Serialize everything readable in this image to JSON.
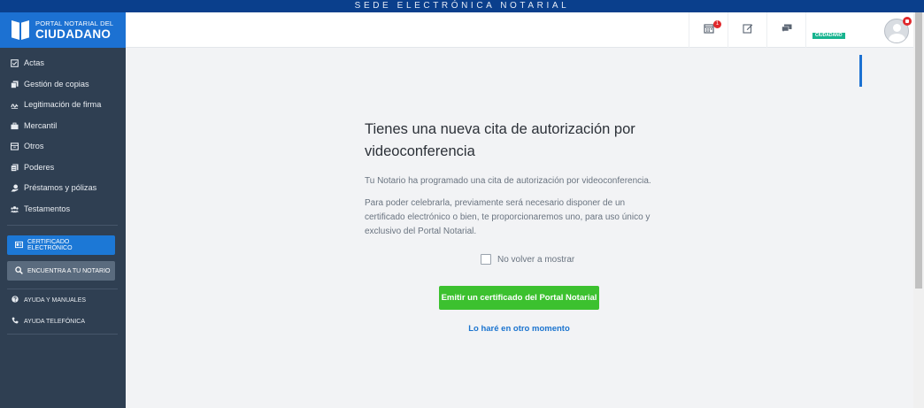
{
  "banner": "SEDE ELECTRÓNICA NOTARIAL",
  "logo": {
    "line1": "PORTAL NOTARIAL DEL",
    "line2": "CIUDADANO"
  },
  "header": {
    "calendar_badge": "1",
    "role_tag": "CIUDADANO"
  },
  "sidebar": {
    "items": [
      {
        "label": "Actas",
        "icon": "check-square-icon"
      },
      {
        "label": "Gestión de copias",
        "icon": "copy-icon"
      },
      {
        "label": "Legitimación de firma",
        "icon": "signature-icon"
      },
      {
        "label": "Mercantil",
        "icon": "briefcase-icon"
      },
      {
        "label": "Otros",
        "icon": "box-icon"
      },
      {
        "label": "Poderes",
        "icon": "documents-icon"
      },
      {
        "label": "Préstamos y pólizas",
        "icon": "hand-coin-icon"
      },
      {
        "label": "Testamentos",
        "icon": "people-icon"
      }
    ],
    "cert_button": "CERTIFICADO ELECTRÓNICO",
    "find_button": "ENCUENTRA A TU NOTARIO",
    "help": [
      {
        "label": "AYUDA Y MANUALES",
        "icon": "question-icon"
      },
      {
        "label": "AYUDA TELEFÓNICA",
        "icon": "phone-icon"
      }
    ]
  },
  "main": {
    "title_line1": "Tienes una nueva cita de autorización por",
    "title_line2": "videoconferencia",
    "para1": "Tu Notario ha programado una cita de autorización por videoconferencia.",
    "para2": "Para poder celebrarla, previamente será necesario disponer de un certificado electrónico o bien, te proporcionaremos uno, para uso único y exclusivo del Portal Notarial.",
    "checkbox_label": "No volver a mostrar",
    "checkbox_checked": false,
    "primary_button": "Emitir un certificado del Portal Notarial",
    "secondary_link": "Lo haré en otro momento"
  },
  "colors": {
    "brand_blue": "#1c71d2",
    "sidebar_bg": "#2f3f52",
    "primary_green": "#3cc12f",
    "badge_red": "#e0282c"
  }
}
